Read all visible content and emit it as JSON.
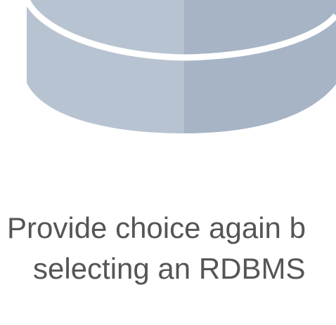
{
  "illustration": {
    "icon": "database-icon",
    "colors": {
      "left_face": "#b8c3d1",
      "right_face": "#a6b4c6",
      "separator": "#ffffff"
    }
  },
  "caption": {
    "line1": "Provide choice again b",
    "line2": "selecting an RDBMS",
    "color": "#555555"
  }
}
